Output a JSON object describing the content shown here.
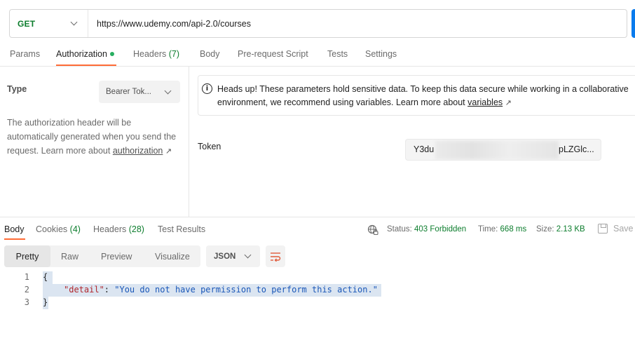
{
  "request": {
    "method": "GET",
    "url": "https://www.udemy.com/api-2.0/courses"
  },
  "request_tabs": [
    {
      "label": "Params"
    },
    {
      "label": "Authorization"
    },
    {
      "label": "Headers",
      "count": "(7)"
    },
    {
      "label": "Body"
    },
    {
      "label": "Pre-request Script"
    },
    {
      "label": "Tests"
    },
    {
      "label": "Settings"
    }
  ],
  "auth": {
    "type_label": "Type",
    "type_value": "Bearer Tok...",
    "description": "The authorization header will be automatically generated when you send the request. Learn more about",
    "learn_link": "authorization",
    "notice_line1": "Heads up! These parameters hold sensitive data. To keep this data secure while working in a collaborative",
    "notice_line2": "environment, we recommend using variables. Learn more about",
    "notice_link": "variables",
    "token_label": "Token",
    "token_start": "Y3du",
    "token_end": "pLZGlc..."
  },
  "response_tabs": [
    {
      "label": "Body"
    },
    {
      "label": "Cookies",
      "count": "(4)"
    },
    {
      "label": "Headers",
      "count": "(28)"
    },
    {
      "label": "Test Results"
    }
  ],
  "response_status": {
    "status_label": "Status:",
    "status_value": "403 Forbidden",
    "time_label": "Time:",
    "time_value": "668 ms",
    "size_label": "Size:",
    "size_value": "2.13 KB",
    "save_label": "Save"
  },
  "format": {
    "modes": [
      "Pretty",
      "Raw",
      "Preview",
      "Visualize"
    ],
    "language": "JSON"
  },
  "body_lines": [
    {
      "num": "1",
      "text": "{"
    },
    {
      "num": "2",
      "key": "\"detail\"",
      "sep": ": ",
      "value": "\"You do not have permission to perform this action.\""
    },
    {
      "num": "3",
      "text": "}"
    }
  ],
  "colors": {
    "accent": "#ff6c37",
    "success_green": "#0c7d2d",
    "send_blue": "#097bed"
  }
}
